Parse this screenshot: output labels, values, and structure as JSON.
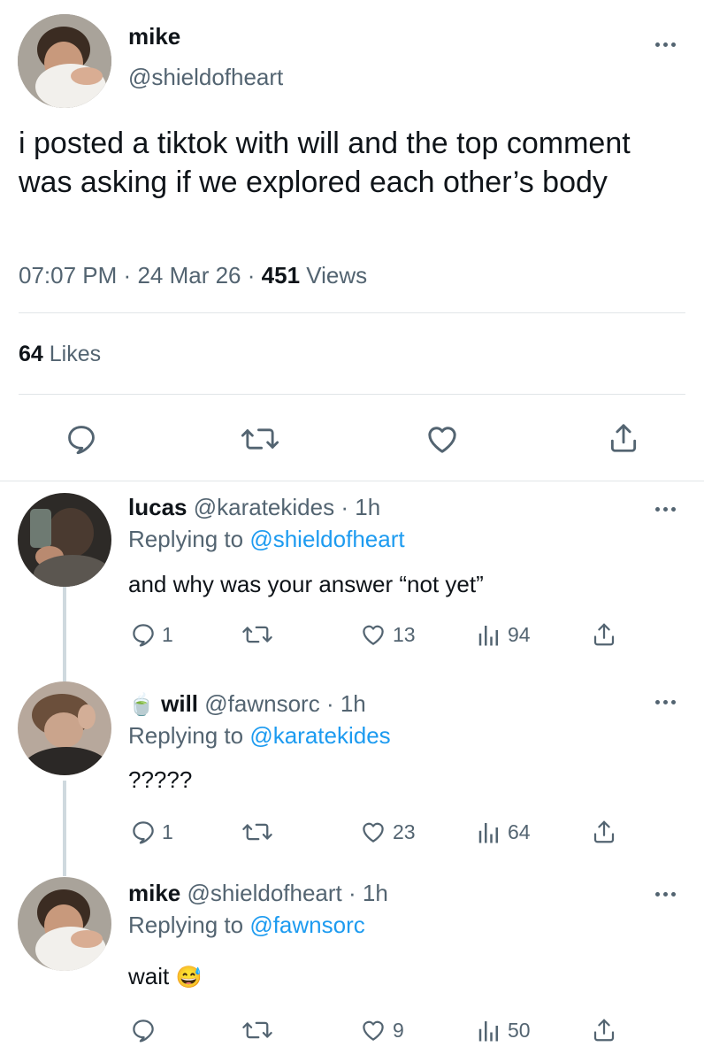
{
  "main_tweet": {
    "display_name": "mike",
    "handle": "@shieldofheart",
    "text": "i posted a tiktok with will and the top comment was asking if we explored each other’s body",
    "time": "07:07 PM",
    "date": "24 Mar 26",
    "views_count": "451",
    "views_label": "Views",
    "likes_count": "64",
    "likes_label": "Likes",
    "dot": "·"
  },
  "replies": [
    {
      "display_name": "lucas",
      "handle": "@karatekides",
      "time": "1h",
      "replying_prefix": "Replying to",
      "replying_to": "@shieldofheart",
      "text": "and why was your answer “not yet”",
      "reply_count": "1",
      "retweet_count": "",
      "like_count": "13",
      "view_count": "94"
    },
    {
      "emoji": "🍵",
      "display_name": "will",
      "handle": "@fawnsorc",
      "time": "1h",
      "replying_prefix": "Replying to",
      "replying_to": "@karatekides",
      "text": "?????",
      "reply_count": "1",
      "retweet_count": "",
      "like_count": "23",
      "view_count": "64"
    },
    {
      "display_name": "mike",
      "handle": "@shieldofheart",
      "time": "1h",
      "replying_prefix": "Replying to",
      "replying_to": "@fawnsorc",
      "text": "wait",
      "emoji_after": "😅",
      "reply_count": "",
      "retweet_count": "",
      "like_count": "9",
      "view_count": "50"
    }
  ],
  "colors": {
    "accent": "#1d9bf0",
    "text": "#0f1419",
    "secondary": "#536471",
    "divider": "#e1e5e8"
  },
  "icons": [
    "more-icon",
    "reply-icon",
    "retweet-icon",
    "like-icon",
    "share-icon",
    "views-icon",
    "avatar"
  ]
}
